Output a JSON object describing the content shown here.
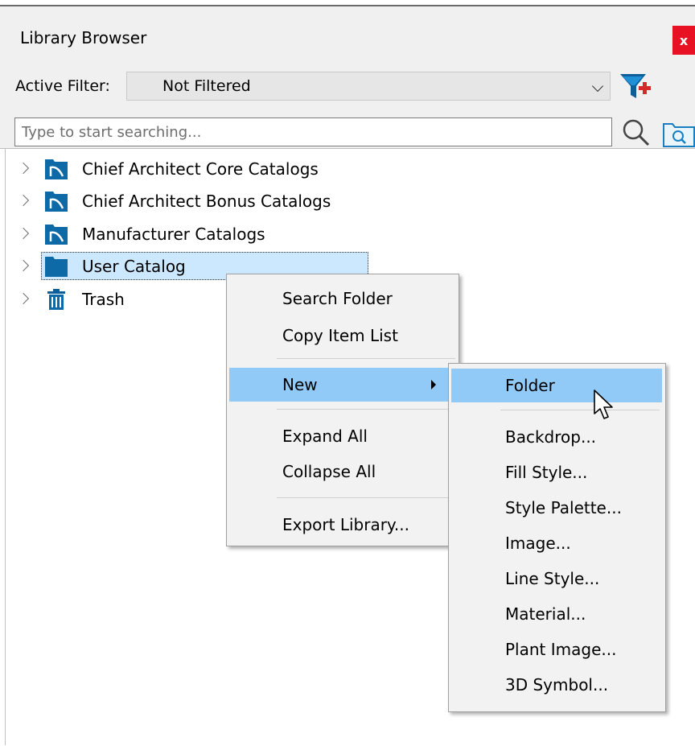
{
  "window": {
    "title": "Library Browser",
    "close_label": "x"
  },
  "filter": {
    "label": "Active Filter:",
    "value": "Not Filtered"
  },
  "search": {
    "placeholder": "Type to start searching..."
  },
  "tree": {
    "items": [
      {
        "label": "Chief Architect Core Catalogs",
        "icon": "catalog-folder-icon"
      },
      {
        "label": "Chief Architect Bonus Catalogs",
        "icon": "catalog-folder-icon"
      },
      {
        "label": "Manufacturer Catalogs",
        "icon": "catalog-folder-icon"
      },
      {
        "label": "User Catalog",
        "icon": "folder-icon",
        "selected": true
      },
      {
        "label": "Trash",
        "icon": "trash-icon"
      }
    ]
  },
  "context_menu": {
    "search_folder": "Search Folder",
    "copy_item_list": "Copy Item List",
    "new": "New",
    "expand_all": "Expand All",
    "collapse_all": "Collapse All",
    "export_library": "Export Library..."
  },
  "submenu": {
    "items": [
      "Folder",
      "Backdrop...",
      "Fill Style...",
      "Style Palette...",
      "Image...",
      "Line Style...",
      "Material...",
      "Plant Image...",
      "3D Symbol..."
    ]
  },
  "colors": {
    "accent": "#0d6aa6",
    "highlight": "#91c9f7",
    "selection": "#cce8ff",
    "close": "#e81123"
  }
}
